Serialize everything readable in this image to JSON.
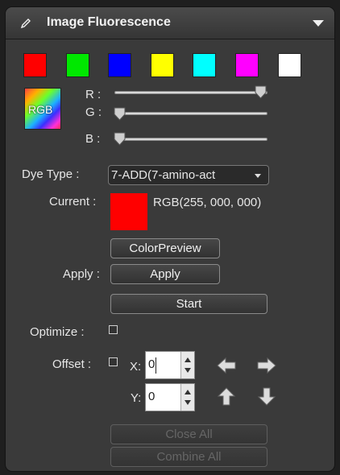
{
  "header": {
    "icon": "pen-icon",
    "title": "Image Fluorescence",
    "collapse_icon": "triangle-down-icon"
  },
  "palette": [
    {
      "name": "red",
      "color": "#ff0000"
    },
    {
      "name": "green",
      "color": "#00e800"
    },
    {
      "name": "blue",
      "color": "#0000ff"
    },
    {
      "name": "yellow",
      "color": "#ffff00"
    },
    {
      "name": "cyan",
      "color": "#00ffff"
    },
    {
      "name": "magenta",
      "color": "#ff00ff"
    },
    {
      "name": "white",
      "color": "#ffffff"
    }
  ],
  "rgb_icon_label": "RGB",
  "sliders": {
    "r": {
      "label": "R :",
      "value": 255
    },
    "g": {
      "label": "G :",
      "value": 0
    },
    "b": {
      "label": "B :",
      "value": 0
    }
  },
  "dye_type": {
    "label": "Dye Type :",
    "value": "7-ADD(7-amino-act"
  },
  "current": {
    "label": "Current :",
    "color": "#ff0000",
    "text": "RGB(255, 000, 000)"
  },
  "buttons": {
    "color_preview": "ColorPreview",
    "apply_label": "Apply :",
    "apply": "Apply",
    "start": "Start",
    "close_all": "Close All",
    "combine_all": "Combine All"
  },
  "optimize": {
    "label": "Optimize :",
    "checked": false
  },
  "offset": {
    "label": "Offset :",
    "checked": false,
    "x_label": "X:",
    "x_value": "0",
    "y_label": "Y:",
    "y_value": "0"
  },
  "arrow_icons": [
    "arrow-left-icon",
    "arrow-right-icon",
    "arrow-up-icon",
    "arrow-down-icon"
  ]
}
